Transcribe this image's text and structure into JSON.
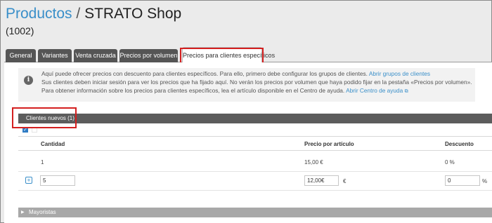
{
  "header": {
    "title_link": "Productos",
    "separator": "/",
    "title_shop": "STRATO Shop",
    "subtitle": "(1002)"
  },
  "tabs": [
    {
      "label": "General"
    },
    {
      "label": "Variantes"
    },
    {
      "label": "Venta cruzada"
    },
    {
      "label": "Precios por volumen"
    },
    {
      "label": "Precios para clientes específicos"
    }
  ],
  "info": {
    "line1_text": "Aquí puede ofrecer precios con descuento para clientes específicos. Para ello, primero debe configurar los grupos de clientes.",
    "line1_link": "Abrir grupos de clientes",
    "line2_text": "Sus clientes deben iniciar sesión para ver los precios que ha fijado aquí. No verán los precios por volumen que haya podido fijar en la pestaña «Precios por volumen».",
    "line3_text": "Para obtener información sobre los precios para clientes específicos, lea el artículo disponible en el Centro de ayuda.",
    "line3_link": "Abrir Centro de ayuda",
    "info_icon": "info-icon",
    "external_icon": "external-link-icon"
  },
  "groups": {
    "group1_label": "Clientes nuevos (1)",
    "group2_label": "Mayoristas"
  },
  "table": {
    "headers": {
      "quantity": "Cantidad",
      "price": "Precio por artículo",
      "discount": "Descuento"
    },
    "row1": {
      "quantity": "1",
      "price": "15,00 €",
      "discount": "0 %"
    },
    "row2": {
      "quantity": "5",
      "price": "12,00€",
      "currency": "€",
      "discount": "0",
      "percent": "%"
    }
  },
  "colors": {
    "accent": "#3a8fc9",
    "highlight": "#d42020",
    "tab_bg": "#555555",
    "group_bar": "#5c5c5c"
  }
}
